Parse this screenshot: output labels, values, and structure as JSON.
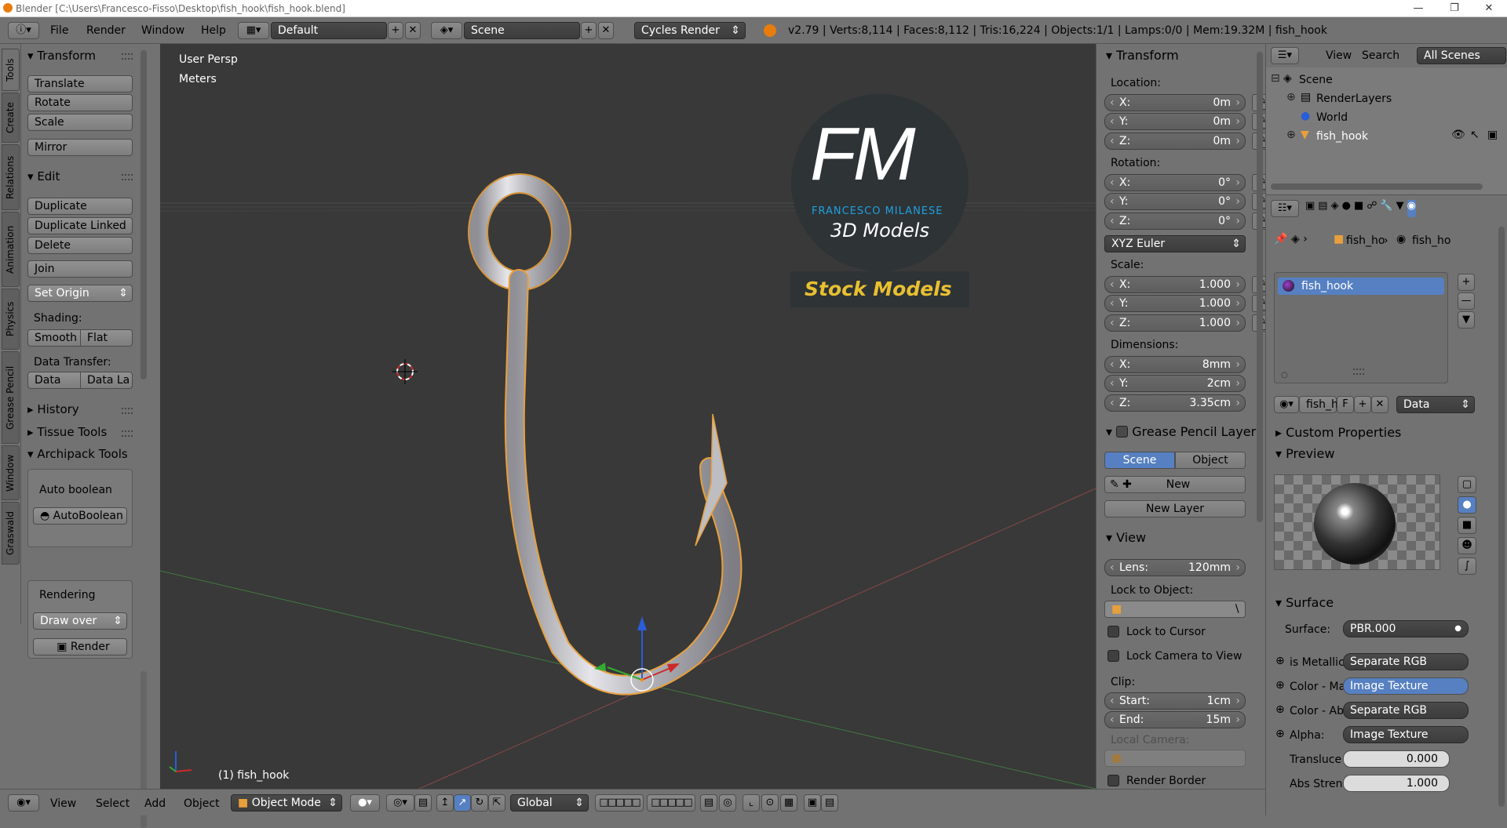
{
  "window": {
    "title": "Blender [C:\\Users\\Francesco-Fisso\\Desktop\\fish_hook\\fish_hook.blend]"
  },
  "menu": [
    "File",
    "Render",
    "Window",
    "Help"
  ],
  "layout": {
    "screen": "Default",
    "scene": "Scene",
    "engine": "Cycles Render"
  },
  "stats": "v2.79 | Verts:8,114 | Faces:8,112 | Tris:16,224 | Objects:1/1 | Lamps:0/0 | Mem:19.32M | fish_hook",
  "left_tabs": [
    "Tools",
    "Create",
    "Relations",
    "Animation",
    "Physics",
    "Grease Pencil",
    "Window",
    "Graswald"
  ],
  "toolshelf": {
    "transform_header": "Transform",
    "translate": "Translate",
    "rotate": "Rotate",
    "scale": "Scale",
    "mirror": "Mirror",
    "edit_header": "Edit",
    "duplicate": "Duplicate",
    "duplicate_linked": "Duplicate Linked",
    "delete": "Delete",
    "join": "Join",
    "set_origin": "Set Origin",
    "shading_label": "Shading:",
    "smooth": "Smooth",
    "flat": "Flat",
    "data_transfer_label": "Data Transfer:",
    "data": "Data",
    "data_la": "Data La",
    "history": "History",
    "tissue_tools": "Tissue Tools",
    "archipack_tools": "Archipack Tools",
    "auto_boolean_label": "Auto boolean",
    "auto_boolean_button": "AutoBoolean",
    "rendering_label": "Rendering",
    "draw_over": "Draw over",
    "render": "Render"
  },
  "viewport": {
    "view_name": "User Persp",
    "units": "Meters",
    "object_label": "(1) fish_hook",
    "logo_letters": "FM",
    "logo_name": "FRANCESCO MILANESE",
    "logo_sub": "3D Models",
    "logo_banner": "Stock Models",
    "colors": {
      "bg": "#393939",
      "select": "#e8a03c",
      "axis_x": "#c84b4b",
      "axis_y": "#4aa84a",
      "logo_blue": "#1fa0e0",
      "banner_yellow": "#f5c400"
    }
  },
  "npanel": {
    "transform_header": "Transform",
    "location_label": "Location:",
    "location": [
      {
        "axis": "X:",
        "value": "0m"
      },
      {
        "axis": "Y:",
        "value": "0m"
      },
      {
        "axis": "Z:",
        "value": "0m"
      }
    ],
    "rotation_label": "Rotation:",
    "rotation": [
      {
        "axis": "X:",
        "value": "0°"
      },
      {
        "axis": "Y:",
        "value": "0°"
      },
      {
        "axis": "Z:",
        "value": "0°"
      }
    ],
    "rotation_mode": "XYZ Euler",
    "scale_label": "Scale:",
    "scale": [
      {
        "axis": "X:",
        "value": "1.000"
      },
      {
        "axis": "Y:",
        "value": "1.000"
      },
      {
        "axis": "Z:",
        "value": "1.000"
      }
    ],
    "dimensions_label": "Dimensions:",
    "dimensions": [
      {
        "axis": "X:",
        "value": "8mm"
      },
      {
        "axis": "Y:",
        "value": "2cm"
      },
      {
        "axis": "Z:",
        "value": "3.35cm"
      }
    ],
    "grease_header": "Grease Pencil Layer",
    "scene_tab": "Scene",
    "object_tab": "Object",
    "new": "New",
    "new_layer": "New Layer",
    "view_header": "View",
    "lens": {
      "axis": "Lens:",
      "value": "120mm"
    },
    "lock_object_label": "Lock to Object:",
    "lock_cursor": "Lock to Cursor",
    "lock_camera": "Lock Camera to View",
    "clip_label": "Clip:",
    "clip_start": {
      "axis": "Start:",
      "value": "1cm"
    },
    "clip_end": {
      "axis": "End:",
      "value": "15m"
    },
    "local_camera_label": "Local Camera:",
    "render_border": "Render Border"
  },
  "outliner": {
    "view": "View",
    "search": "Search",
    "all_scenes": "All Scenes",
    "tree": [
      "Scene",
      "RenderLayers",
      "World",
      "fish_hook"
    ]
  },
  "properties": {
    "breadcrumb": [
      "fish_ho",
      "fish_ho"
    ],
    "material_slot": "fish_hook",
    "mat_name": "fish_h",
    "mat_f": "F",
    "data_dropdown": "Data",
    "custom_properties": "Custom Properties",
    "preview": "Preview",
    "surface_header": "Surface",
    "surface_label": "Surface:",
    "surface_value": "PBR.000",
    "sockets": [
      {
        "label": "is Metallic",
        "value": "Separate RGB"
      },
      {
        "label": "Color - Ma",
        "value": "Image Texture",
        "highlight": true
      },
      {
        "label": "Color - Ab",
        "value": "Separate RGB"
      },
      {
        "label": "Alpha:",
        "value": "Image Texture"
      }
    ],
    "translucence": {
      "label": "Transluce",
      "value": "0.000"
    },
    "abs_strength": {
      "label": "Abs Stren",
      "value": "1.000"
    }
  },
  "bottombar": {
    "view": "View",
    "select": "Select",
    "add": "Add",
    "object": "Object",
    "mode": "Object Mode",
    "orientation": "Global"
  }
}
